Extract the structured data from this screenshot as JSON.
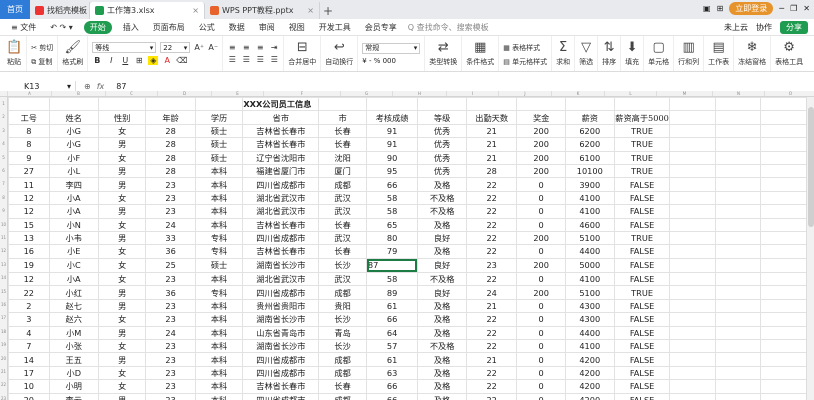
{
  "tabs": {
    "home": "首页",
    "doc1": "找稻壳模板",
    "doc2": "工作簿3.xlsx",
    "doc3": "WPS PPT教程.pptx",
    "add": "+"
  },
  "titlebar": {
    "login": "立即登录"
  },
  "menu": {
    "file": "≡ 文件",
    "items": [
      "插入",
      "页面布局",
      "公式",
      "数据",
      "审阅",
      "视图",
      "开发工具",
      "会员专享"
    ],
    "start": "开始",
    "search": "Q 查找命令、搜索模板",
    "cloud": "未上云",
    "collab": "协作",
    "share": "分享"
  },
  "ribbon": {
    "paste": "粘贴",
    "cut": "剪切",
    "copy": "复制",
    "format": "格式刷",
    "font_name": "等线",
    "font_size": "22",
    "bold": "B",
    "italic": "I",
    "underline": "U",
    "font_color": "A",
    "merge": "合并居中",
    "wrap": "自动换行",
    "numfmt": "常规",
    "percent": "¥ - % 000",
    "type_convert": "类型转换",
    "cond_format": "条件格式",
    "cell_style": "单元格样式",
    "table_style": "表格样式",
    "sum": "求和",
    "filter": "筛选",
    "sort": "排序",
    "fill": "填充",
    "cell": "单元格",
    "rowcol": "行和列",
    "sheet": "工作表",
    "freeze": "冻结窗格",
    "table_tools": "表格工具"
  },
  "formula": {
    "cell": "K13",
    "value": "87",
    "fx": "fx"
  },
  "columns": [
    "A",
    "B",
    "C",
    "D",
    "E",
    "F",
    "G",
    "H",
    "I",
    "J",
    "K",
    "L",
    "M",
    "N",
    "O",
    "P"
  ],
  "title_row": "XXX公司员工信息",
  "headers": [
    "工号",
    "姓名",
    "性别",
    "年龄",
    "学历",
    "省市",
    "市",
    "考核成绩",
    "等级",
    "出勤天数",
    "奖金",
    "薪资",
    "薪资高于5000"
  ],
  "rows": [
    [
      "8",
      "小G",
      "女",
      "28",
      "硕士",
      "吉林省长春市",
      "长春",
      "91",
      "优秀",
      "21",
      "200",
      "6200",
      "TRUE"
    ],
    [
      "8",
      "小G",
      "男",
      "28",
      "硕士",
      "吉林省长春市",
      "长春",
      "91",
      "优秀",
      "21",
      "200",
      "6200",
      "TRUE"
    ],
    [
      "9",
      "小F",
      "女",
      "28",
      "硕士",
      "辽宁省沈阳市",
      "沈阳",
      "90",
      "优秀",
      "21",
      "200",
      "6100",
      "TRUE"
    ],
    [
      "27",
      "小L",
      "男",
      "28",
      "本科",
      "福建省厦门市",
      "厦门",
      "95",
      "优秀",
      "28",
      "200",
      "10100",
      "TRUE"
    ],
    [
      "11",
      "李四",
      "男",
      "23",
      "本科",
      "四川省成都市",
      "成都",
      "66",
      "及格",
      "22",
      "0",
      "3900",
      "FALSE"
    ],
    [
      "12",
      "小A",
      "女",
      "23",
      "本科",
      "湖北省武汉市",
      "武汉",
      "58",
      "不及格",
      "22",
      "0",
      "4100",
      "FALSE"
    ],
    [
      "12",
      "小A",
      "男",
      "23",
      "本科",
      "湖北省武汉市",
      "武汉",
      "58",
      "不及格",
      "22",
      "0",
      "4100",
      "FALSE"
    ],
    [
      "15",
      "小N",
      "女",
      "24",
      "本科",
      "吉林省长春市",
      "长春",
      "65",
      "及格",
      "22",
      "0",
      "4600",
      "FALSE"
    ],
    [
      "13",
      "小韦",
      "男",
      "33",
      "专科",
      "四川省成都市",
      "武汉",
      "80",
      "良好",
      "22",
      "200",
      "5100",
      "TRUE"
    ],
    [
      "16",
      "小E",
      "女",
      "36",
      "专科",
      "吉林省长春市",
      "长春",
      "79",
      "及格",
      "22",
      "0",
      "4400",
      "FALSE"
    ],
    [
      "19",
      "小C",
      "女",
      "25",
      "硕士",
      "湖南省长沙市",
      "长沙",
      "87",
      "良好",
      "23",
      "200",
      "5000",
      "FALSE"
    ],
    [
      "12",
      "小A",
      "女",
      "23",
      "本科",
      "湖北省武汉市",
      "武汉",
      "58",
      "不及格",
      "22",
      "0",
      "4100",
      "FALSE"
    ],
    [
      "22",
      "小红",
      "男",
      "36",
      "专科",
      "四川省成都市",
      "成都",
      "89",
      "良好",
      "24",
      "200",
      "5100",
      "TRUE"
    ],
    [
      "2",
      "赵七",
      "男",
      "23",
      "本科",
      "贵州省贵阳市",
      "贵阳",
      "61",
      "及格",
      "21",
      "0",
      "4300",
      "FALSE"
    ],
    [
      "3",
      "赵六",
      "女",
      "23",
      "本科",
      "湖南省长沙市",
      "长沙",
      "66",
      "及格",
      "22",
      "0",
      "4300",
      "FALSE"
    ],
    [
      "4",
      "小M",
      "男",
      "24",
      "本科",
      "山东省青岛市",
      "青岛",
      "64",
      "及格",
      "22",
      "0",
      "4400",
      "FALSE"
    ],
    [
      "7",
      "小张",
      "女",
      "23",
      "本科",
      "湖南省长沙市",
      "长沙",
      "57",
      "不及格",
      "22",
      "0",
      "4100",
      "FALSE"
    ],
    [
      "14",
      "王五",
      "男",
      "23",
      "本科",
      "四川省成都市",
      "成都",
      "61",
      "及格",
      "21",
      "0",
      "4200",
      "FALSE"
    ],
    [
      "17",
      "小D",
      "女",
      "23",
      "本科",
      "四川省成都市",
      "成都",
      "63",
      "及格",
      "22",
      "0",
      "4200",
      "FALSE"
    ],
    [
      "10",
      "小明",
      "女",
      "23",
      "本科",
      "吉林省长春市",
      "长春",
      "66",
      "及格",
      "22",
      "0",
      "4200",
      "FALSE"
    ],
    [
      "20",
      "李云",
      "男",
      "23",
      "本科",
      "四川省成都市",
      "成都",
      "66",
      "及格",
      "22",
      "0",
      "4200",
      "FALSE"
    ]
  ],
  "row_numbers": [
    "1",
    "2",
    "3",
    "4",
    "5",
    "6",
    "7",
    "8",
    "9",
    "10",
    "11",
    "12",
    "13",
    "14",
    "15",
    "16",
    "17",
    "18",
    "19",
    "20",
    "21",
    "22",
    "23"
  ]
}
